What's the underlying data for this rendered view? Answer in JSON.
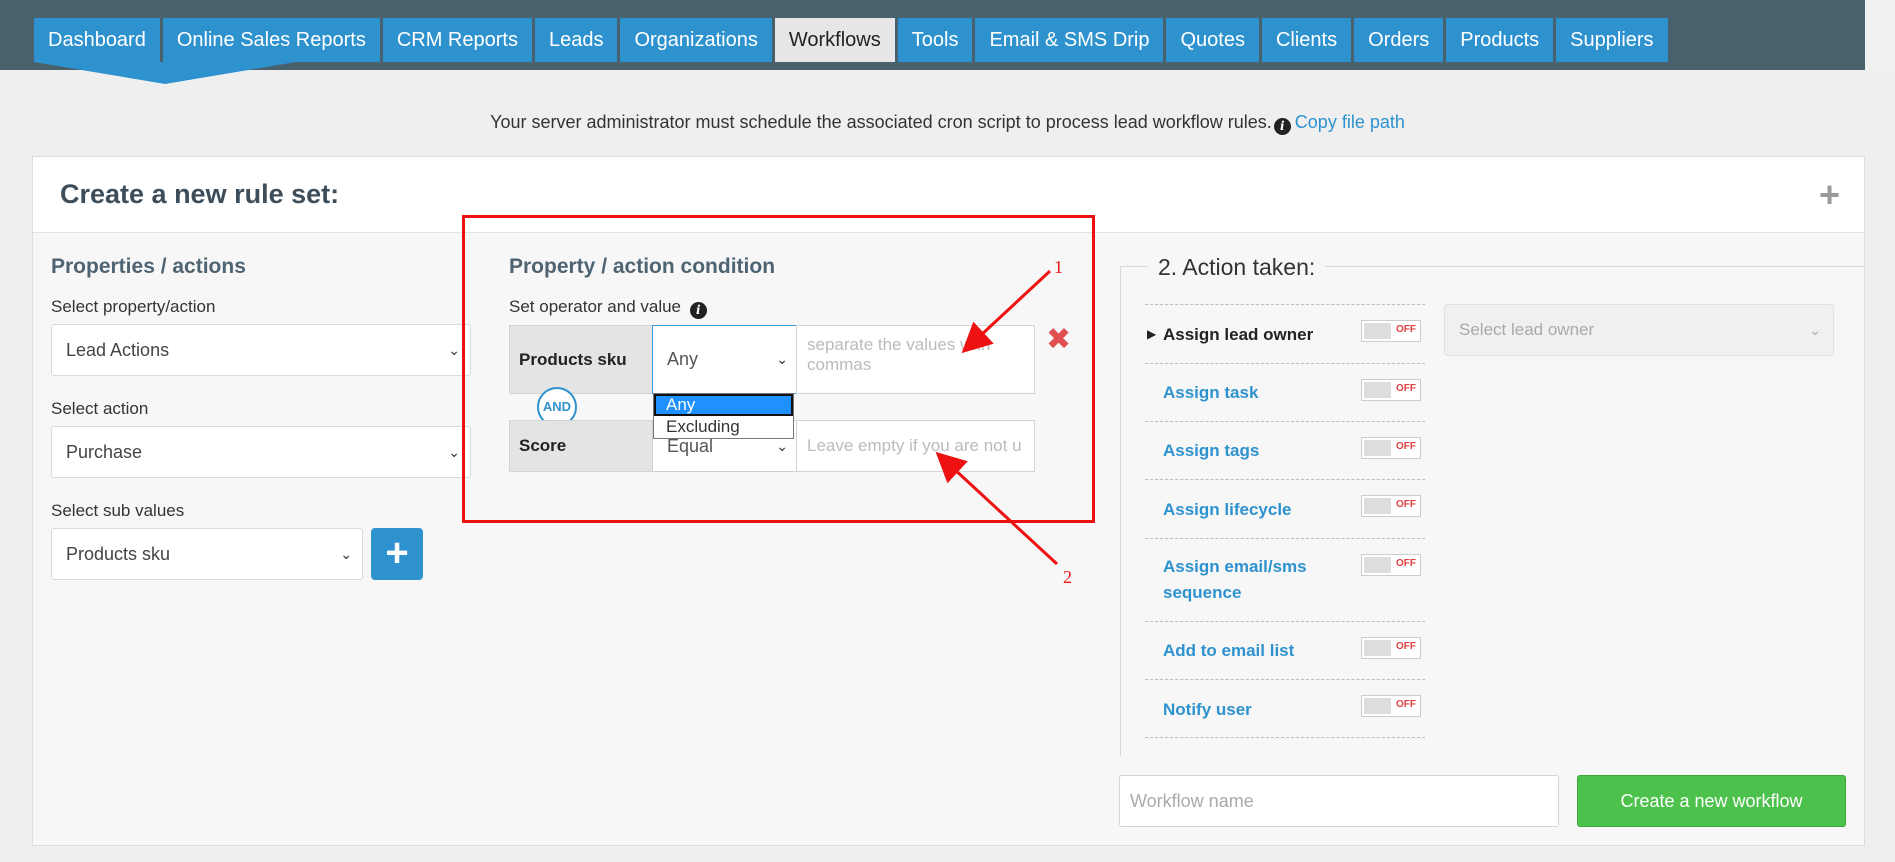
{
  "nav": {
    "items": [
      {
        "label": "Dashboard",
        "active": false
      },
      {
        "label": "Online Sales Reports",
        "active": false
      },
      {
        "label": "CRM Reports",
        "active": false
      },
      {
        "label": "Leads",
        "active": false
      },
      {
        "label": "Organizations",
        "active": false
      },
      {
        "label": "Workflows",
        "active": true
      },
      {
        "label": "Tools",
        "active": false
      },
      {
        "label": "Email & SMS Drip",
        "active": false
      },
      {
        "label": "Quotes",
        "active": false
      },
      {
        "label": "Clients",
        "active": false
      },
      {
        "label": "Orders",
        "active": false
      },
      {
        "label": "Products",
        "active": false
      },
      {
        "label": "Suppliers",
        "active": false
      }
    ]
  },
  "notice": {
    "text": "Your server administrator must schedule the associated cron script to process lead workflow rules.",
    "link": "Copy file path"
  },
  "panel": {
    "title": "Create a new rule set:"
  },
  "properties": {
    "heading": "Properties / actions",
    "property_label": "Select property/action",
    "property_value": "Lead Actions",
    "action_label": "Select action",
    "action_value": "Purchase",
    "sub_label": "Select sub values",
    "sub_value": "Products sku"
  },
  "condition": {
    "heading": "Property / action condition",
    "operator_label": "Set operator and value",
    "rows": [
      {
        "name": "Products sku",
        "operator": "Any",
        "placeholder": "separate the values with commas"
      },
      {
        "name": "Score",
        "operator": "Equal",
        "placeholder": "Leave empty if you are not u"
      }
    ],
    "and_label": "AND",
    "dropdown_options": [
      {
        "label": "Any",
        "selected": true
      },
      {
        "label": "Excluding",
        "selected": false
      }
    ]
  },
  "actions": {
    "legend": "2. Action taken:",
    "items": [
      {
        "label": "Assign lead owner",
        "state": "OFF"
      },
      {
        "label": "Assign task",
        "state": "OFF"
      },
      {
        "label": "Assign tags",
        "state": "OFF"
      },
      {
        "label": "Assign lifecycle",
        "state": "OFF"
      },
      {
        "label": "Assign email/sms sequence",
        "state": "OFF"
      },
      {
        "label": "Add to email list",
        "state": "OFF"
      },
      {
        "label": "Notify user",
        "state": "OFF"
      }
    ],
    "owner_placeholder": "Select lead owner"
  },
  "footer": {
    "workflow_name_placeholder": "Workflow name",
    "create_button": "Create a new workflow"
  },
  "annotations": {
    "num1": "1",
    "num2": "2"
  },
  "colors": {
    "nav_bg": "#49606d",
    "accent": "#2e92cf",
    "success": "#4cc14c",
    "annotation": "#ee1111"
  }
}
